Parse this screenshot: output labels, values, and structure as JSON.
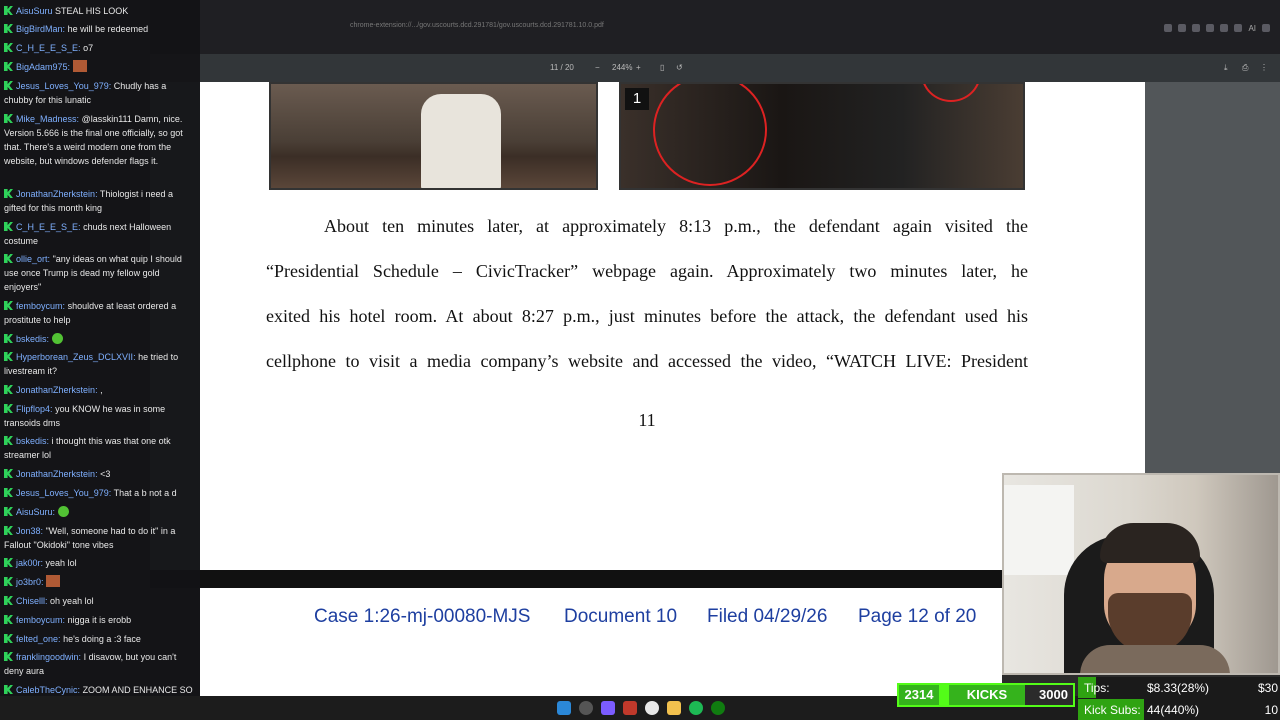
{
  "browser": {
    "url": "chrome-extension://.../gov.uscourts.dcd.291781/gov.uscourts.dcd.291781.10.0.pdf",
    "ext_ai_label": "AI"
  },
  "pdf_toolbar": {
    "page_indicator": "11 / 20",
    "zoom": "244%"
  },
  "document": {
    "photo_badge": "1",
    "paragraph_lines": [
      "About ten minutes later, at approximately 8:13 p.m., the defendant again visited the",
      "“Presidential Schedule – CivicTracker” webpage again.   Approximately two minutes later, he",
      "exited his hotel room.   At about 8:27 p.m., just minutes before the attack, the defendant used his",
      "cellphone to visit a media company’s website and accessed the video, “WATCH LIVE: President"
    ],
    "page_number": "11",
    "footer": {
      "case": "Case 1:26-mj-00080-MJS",
      "document": "Document 10",
      "filed": "Filed 04/29/26",
      "page": "Page 12 of 20"
    }
  },
  "chat": {
    "messages": [
      {
        "user": "AisuSuru",
        "text": "STEAL HIS LOOK"
      },
      {
        "user": "BigBirdMan",
        "text": "he will be redeemed"
      },
      {
        "user": "C_H_E_E_S_E",
        "text": "o7"
      },
      {
        "user": "BigAdam975",
        "text": ""
      },
      {
        "user": "Jesus_Loves_You_979",
        "text": "Chudly has a chubby for this lunatic"
      },
      {
        "user": "Mike_Madness",
        "text": "@lasskin111 Damn, nice. Version 5.666 is the final one officially, so got that. There's a weird modern one from the website, but windows defender flags it."
      },
      {
        "user": "JonathanZherkstein",
        "text": "Thiologist i need a gifted for this month king"
      },
      {
        "user": "C_H_E_E_S_E",
        "text": "chuds next Halloween costume"
      },
      {
        "user": "ollie_ort",
        "text": "\"any ideas on what quip I should use once Trump is dead my fellow gold enjoyers\""
      },
      {
        "user": "femboycum",
        "text": "shouldve at least ordered a prostitute to help"
      },
      {
        "user": "bskedis",
        "text": ""
      },
      {
        "user": "Hyperborean_Zeus_DCLXVII",
        "text": "he tried to livestream it?"
      },
      {
        "user": "JonathanZherkstein",
        "text": ","
      },
      {
        "user": "Flipflop4",
        "text": "you KNOW he was in some transoids dms"
      },
      {
        "user": "bskedis",
        "text": "i thought this was that one otk streamer lol"
      },
      {
        "user": "JonathanZherkstein",
        "text": "<3"
      },
      {
        "user": "Jesus_Loves_You_979",
        "text": "That a b not a d"
      },
      {
        "user": "AisuSuru",
        "text": ""
      },
      {
        "user": "Jon38",
        "text": "\"Well, someone had to do it\" in a Fallout \"Okidoki\" tone vibes"
      },
      {
        "user": "jak00r",
        "text": "yeah lol"
      },
      {
        "user": "jo3br0",
        "text": ""
      },
      {
        "user": "Chiselll",
        "text": "oh yeah lol"
      },
      {
        "user": "femboycum",
        "text": "nigga it is erobb"
      },
      {
        "user": "felted_one",
        "text": "he's doing a :3 face"
      },
      {
        "user": "franklingoodwin",
        "text": "I disavow, but you can't deny aura"
      },
      {
        "user": "CalebTheCynic",
        "text": "ZOOM AND ENHANCE SO I CAN STUDY THE GUNS"
      }
    ]
  },
  "kicks": {
    "count": "2314",
    "label": "KICKS",
    "goal": "3000",
    "progress": 0.77
  },
  "tips": {
    "tips_label": "Tips:",
    "tips_value": "$8.33(28%)",
    "tips_goal": "$30",
    "tips_progress": 0.28,
    "subs_label": "Kick Subs:",
    "subs_value": "44(440%)",
    "subs_goal": "10",
    "subs_progress": 1.0
  },
  "colors": {
    "kick_green": "#53fc18",
    "footer_blue": "#1e3fa0",
    "chat_username": "#7fb0ff"
  }
}
